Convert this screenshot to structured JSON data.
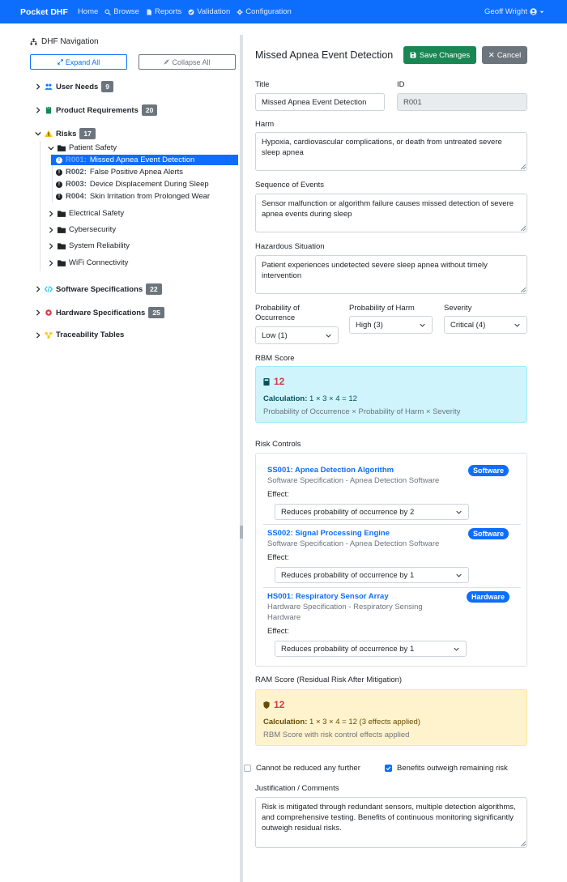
{
  "navbar": {
    "brand": "Pocket DHF",
    "items": [
      {
        "label": "Home",
        "icon": ""
      },
      {
        "label": "Browse",
        "icon": "search-icon"
      },
      {
        "label": "Reports",
        "icon": "file-icon"
      },
      {
        "label": "Validation",
        "icon": "check-circle-icon"
      },
      {
        "label": "Configuration",
        "icon": "gear-icon"
      }
    ],
    "user": "Geoff Wright"
  },
  "sidebar": {
    "title": "DHF Navigation",
    "expand_all": "Expand All",
    "collapse_all": "Collapse All",
    "categories": [
      {
        "label": "User Needs",
        "count": "9",
        "icon_color": "#0d6efd"
      },
      {
        "label": "Product Requirements",
        "count": "20",
        "icon_color": "#198754"
      },
      {
        "label": "Risks",
        "count": "17",
        "icon_color": "#ffc107"
      },
      {
        "label": "Software Specifications",
        "count": "22",
        "icon_color": "#0dcaf0"
      },
      {
        "label": "Hardware Specifications",
        "count": "25",
        "icon_color": "#dc3545"
      },
      {
        "label": "Traceability Tables",
        "count": "",
        "icon_color": "#ffc107"
      }
    ],
    "risk_folders": {
      "patient_safety": "Patient Safety",
      "others": [
        "Electrical Safety",
        "Cybersecurity",
        "System Reliability",
        "WiFi Connectivity"
      ]
    },
    "risk_items": [
      {
        "id": "R001:",
        "label": "Missed Apnea Event Detection"
      },
      {
        "id": "R002:",
        "label": "False Positive Apnea Alerts"
      },
      {
        "id": "R003:",
        "label": "Device Displacement During Sleep"
      },
      {
        "id": "R004:",
        "label": "Skin Irritation from Prolonged Wear"
      }
    ]
  },
  "main": {
    "heading": "Missed Apnea Event Detection",
    "save_label": "Save Changes",
    "cancel_label": "Cancel",
    "title_label": "Title",
    "title_value": "Missed Apnea Event Detection",
    "id_label": "ID",
    "id_value": "R001",
    "harm_label": "Harm",
    "harm_value": "Hypoxia, cardiovascular complications, or death from untreated severe sleep apnea",
    "sequence_label": "Sequence of Events",
    "sequence_value": "Sensor malfunction or algorithm failure causes missed detection of severe apnea events during sleep",
    "hazard_label": "Hazardous Situation",
    "hazard_value": "Patient experiences undetected severe sleep apnea without timely intervention",
    "prob_occ_label": "Probability of Occurrence",
    "prob_occ_value": "Low (1)",
    "prob_harm_label": "Probability of Harm",
    "prob_harm_value": "High (3)",
    "severity_label": "Severity",
    "severity_value": "Critical (4)",
    "rbm_label": "RBM Score",
    "rbm_score": "12",
    "rbm_calc_label": "Calculation:",
    "rbm_calc": "1 × 3 × 4 = 12",
    "rbm_note": "Probability of Occurrence × Probability of Harm × Severity",
    "risk_controls_label": "Risk Controls",
    "controls": [
      {
        "title": "SS001: Apnea Detection Algorithm",
        "sub": "Software Specification - Apnea Detection Software",
        "badge": "Software",
        "effect_label": "Effect:",
        "effect": "Reduces probability of occurrence by 2"
      },
      {
        "title": "SS002: Signal Processing Engine",
        "sub": "Software Specification - Apnea Detection Software",
        "badge": "Software",
        "effect_label": "Effect:",
        "effect": "Reduces probability of occurrence by 1"
      },
      {
        "title": "HS001: Respiratory Sensor Array",
        "sub": "Hardware Specification - Respiratory Sensing Hardware",
        "badge": "Hardware",
        "effect_label": "Effect:",
        "effect": "Reduces probability of occurrence by 1"
      }
    ],
    "ram_label": "RAM Score (Residual Risk After Mitigation)",
    "ram_score": "12",
    "ram_calc_label": "Calculation:",
    "ram_calc": "1 × 3 × 4 = 12 (3 effects applied)",
    "ram_note": "RBM Score with risk control effects applied",
    "cannot_reduce_label": "Cannot be reduced any further",
    "cannot_reduce_checked": false,
    "benefits_label": "Benefits outweigh remaining risk",
    "benefits_checked": true,
    "justification_label": "Justification / Comments",
    "justification_value": "Risk is mitigated through redundant sensors, multiple detection algorithms, and comprehensive testing. Benefits of continuous monitoring significantly outweigh residual risks."
  }
}
